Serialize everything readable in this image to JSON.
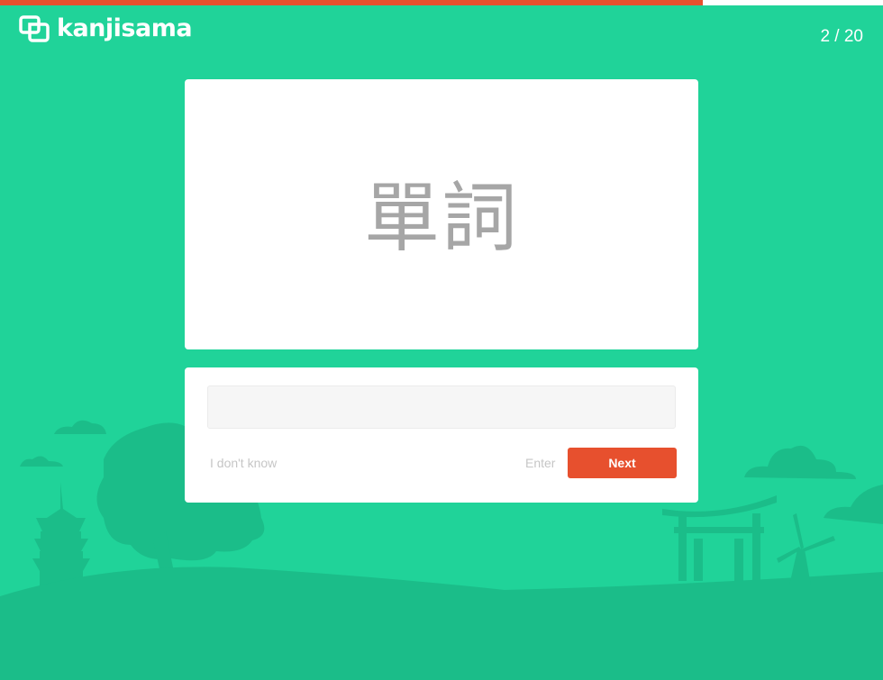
{
  "app": {
    "logo_text": "kanjisama"
  },
  "progress": {
    "fraction": 0.796,
    "counter": "2 / 20"
  },
  "card": {
    "kanji": "單詞"
  },
  "answer": {
    "input_value": "",
    "input_placeholder": "",
    "dont_know_label": "I don't know",
    "enter_hint": "Enter",
    "next_label": "Next"
  },
  "colors": {
    "background": "#20d399",
    "scenery": "#1bbd89",
    "accent": "#e7502e",
    "card": "#ffffff"
  }
}
